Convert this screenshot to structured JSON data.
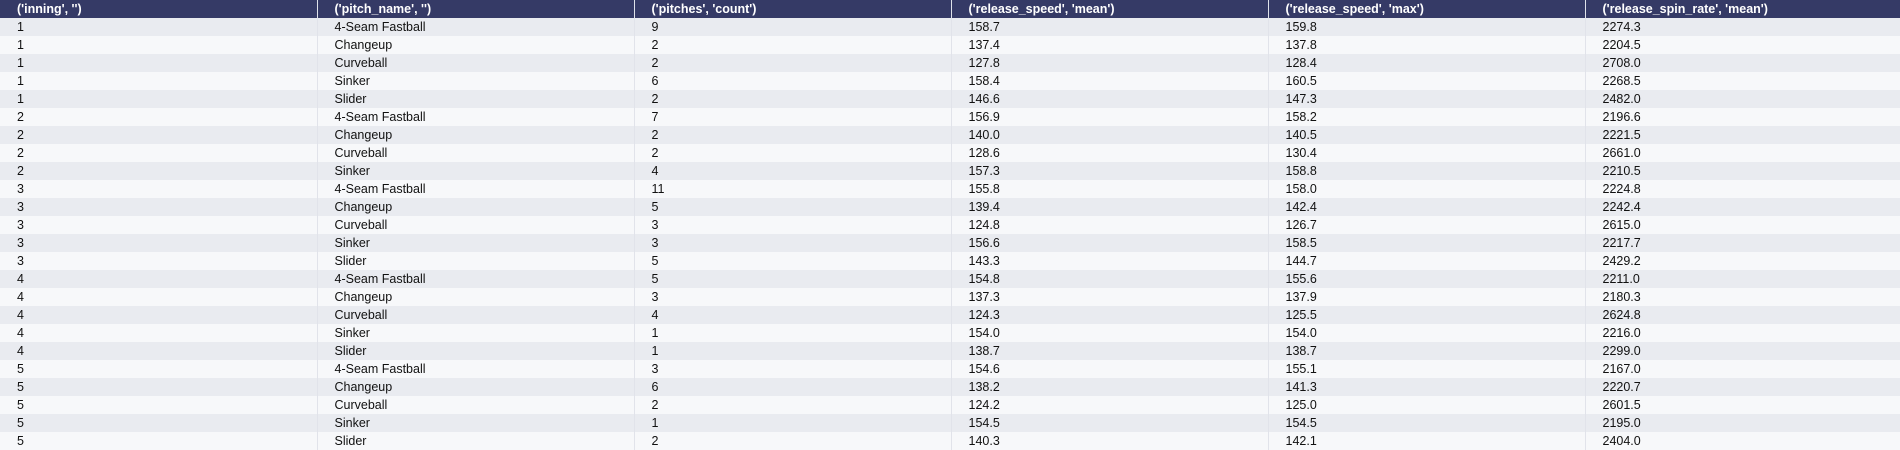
{
  "table": {
    "columns": [
      "('inning', '')",
      "('pitch_name', '')",
      "('pitches', 'count')",
      "('release_speed', 'mean')",
      "('release_speed', 'max')",
      "('release_spin_rate', 'mean')"
    ],
    "rows": [
      [
        "1",
        "4-Seam Fastball",
        "9",
        "158.7",
        "159.8",
        "2274.3"
      ],
      [
        "1",
        "Changeup",
        "2",
        "137.4",
        "137.8",
        "2204.5"
      ],
      [
        "1",
        "Curveball",
        "2",
        "127.8",
        "128.4",
        "2708.0"
      ],
      [
        "1",
        "Sinker",
        "6",
        "158.4",
        "160.5",
        "2268.5"
      ],
      [
        "1",
        "Slider",
        "2",
        "146.6",
        "147.3",
        "2482.0"
      ],
      [
        "2",
        "4-Seam Fastball",
        "7",
        "156.9",
        "158.2",
        "2196.6"
      ],
      [
        "2",
        "Changeup",
        "2",
        "140.0",
        "140.5",
        "2221.5"
      ],
      [
        "2",
        "Curveball",
        "2",
        "128.6",
        "130.4",
        "2661.0"
      ],
      [
        "2",
        "Sinker",
        "4",
        "157.3",
        "158.8",
        "2210.5"
      ],
      [
        "3",
        "4-Seam Fastball",
        "11",
        "155.8",
        "158.0",
        "2224.8"
      ],
      [
        "3",
        "Changeup",
        "5",
        "139.4",
        "142.4",
        "2242.4"
      ],
      [
        "3",
        "Curveball",
        "3",
        "124.8",
        "126.7",
        "2615.0"
      ],
      [
        "3",
        "Sinker",
        "3",
        "156.6",
        "158.5",
        "2217.7"
      ],
      [
        "3",
        "Slider",
        "5",
        "143.3",
        "144.7",
        "2429.2"
      ],
      [
        "4",
        "4-Seam Fastball",
        "5",
        "154.8",
        "155.6",
        "2211.0"
      ],
      [
        "4",
        "Changeup",
        "3",
        "137.3",
        "137.9",
        "2180.3"
      ],
      [
        "4",
        "Curveball",
        "4",
        "124.3",
        "125.5",
        "2624.8"
      ],
      [
        "4",
        "Sinker",
        "1",
        "154.0",
        "154.0",
        "2216.0"
      ],
      [
        "4",
        "Slider",
        "1",
        "138.7",
        "138.7",
        "2299.0"
      ],
      [
        "5",
        "4-Seam Fastball",
        "3",
        "154.6",
        "155.1",
        "2167.0"
      ],
      [
        "5",
        "Changeup",
        "6",
        "138.2",
        "141.3",
        "2220.7"
      ],
      [
        "5",
        "Curveball",
        "2",
        "124.2",
        "125.0",
        "2601.5"
      ],
      [
        "5",
        "Sinker",
        "1",
        "154.5",
        "154.5",
        "2195.0"
      ],
      [
        "5",
        "Slider",
        "2",
        "140.3",
        "142.1",
        "2404.0"
      ]
    ]
  },
  "colors": {
    "header_background": "#353a66",
    "header_text": "#ffffff",
    "row_odd": "#e9ebf0",
    "row_even": "#f7f8fa"
  }
}
